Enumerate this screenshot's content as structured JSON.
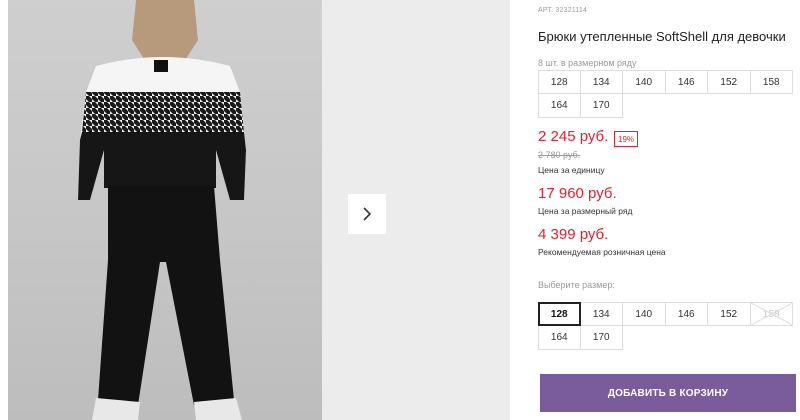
{
  "gallery": {
    "main_image": "Girl in black-and-white houndstooth sweatshirt and black flared pants, back view",
    "next_icon": "chevron-right-icon"
  },
  "product": {
    "sku": "АРТ. 32321114",
    "title": "Брюки утепленные SoftShell для девочки",
    "pack_label": "8 шт. в размерном ряду",
    "pack_sizes": [
      "128",
      "134",
      "140",
      "146",
      "152",
      "158",
      "164",
      "170"
    ],
    "price": "2 245 руб.",
    "discount": "19%",
    "old_price": "2 780 руб.",
    "price_label": "Цена за единицу",
    "set_price": "17 960 руб.",
    "set_price_label": "Цена за размерный ряд",
    "retail_price": "4 399 руб.",
    "retail_price_label": "Рекомендуемая розничная цена",
    "choose_size_label": "Выберите размер:",
    "sizes": [
      {
        "label": "128",
        "selected": true,
        "available": true
      },
      {
        "label": "134",
        "selected": false,
        "available": true
      },
      {
        "label": "140",
        "selected": false,
        "available": true
      },
      {
        "label": "146",
        "selected": false,
        "available": true
      },
      {
        "label": "152",
        "selected": false,
        "available": true
      },
      {
        "label": "158",
        "selected": false,
        "available": false
      },
      {
        "label": "164",
        "selected": false,
        "available": true
      },
      {
        "label": "170",
        "selected": false,
        "available": true
      }
    ],
    "add_to_cart": "ДОБАВИТЬ В КОРЗИНУ"
  },
  "colors": {
    "price_red": "#e5202f",
    "button_purple": "#7a5c9c"
  }
}
